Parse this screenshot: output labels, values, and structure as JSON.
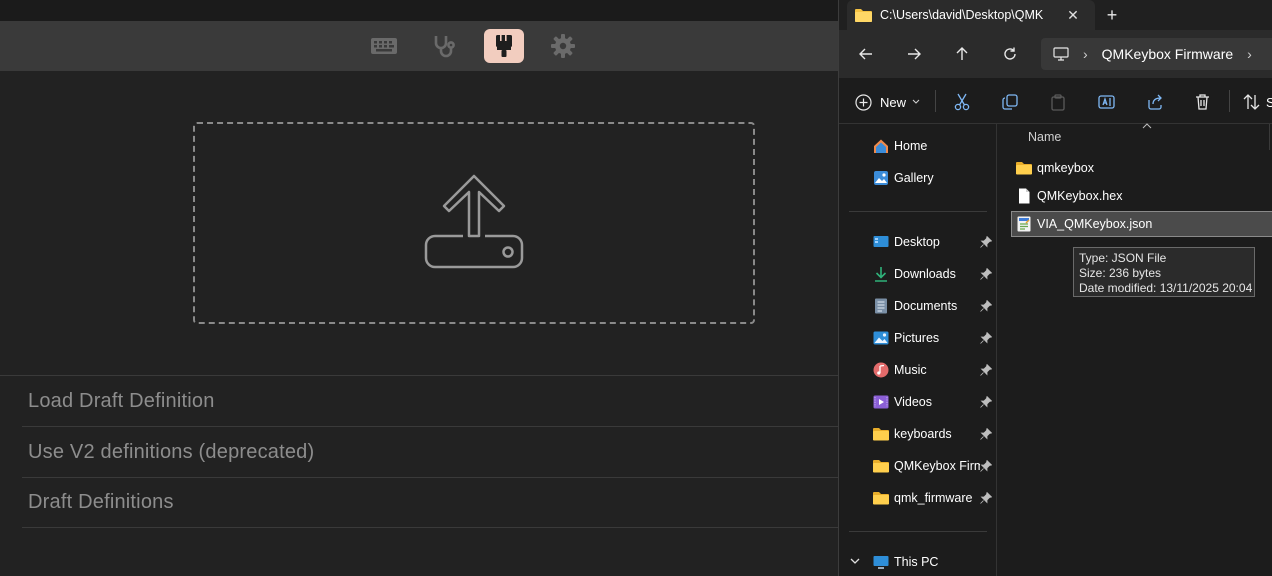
{
  "via": {
    "tabs": [
      {
        "icon": "keyboard-icon",
        "active": false
      },
      {
        "icon": "stethoscope-icon",
        "active": false
      },
      {
        "icon": "paintbrush-icon",
        "active": true
      },
      {
        "icon": "gear-icon",
        "active": false
      }
    ],
    "dropzone_icon": "upload-icon",
    "menu": [
      {
        "label": "Load Draft Definition"
      },
      {
        "label": "Use V2 definitions (deprecated)"
      },
      {
        "label": "Draft Definitions"
      }
    ],
    "colors": {
      "active_tab": "#f2cdbf",
      "text": "#8d8d8d",
      "background": "#222222"
    }
  },
  "explorer": {
    "tab_title": "C:\\Users\\david\\Desktop\\QMK",
    "tab_close": "✕",
    "new_tab": "+",
    "nav": {
      "back": "back-arrow-icon",
      "forward": "forward-arrow-icon",
      "up": "up-arrow-icon",
      "refresh": "refresh-icon"
    },
    "address": {
      "separator": "›",
      "folder": "QMKeybox Firmware",
      "trailing": "›"
    },
    "commands": {
      "new_label": "New",
      "last_label": "S"
    },
    "sidebar": {
      "top": [
        {
          "label": "Home",
          "icon": "home-icon"
        },
        {
          "label": "Gallery",
          "icon": "gallery-icon"
        }
      ],
      "pinned": [
        {
          "label": "Desktop",
          "icon": "desktop-icon"
        },
        {
          "label": "Downloads",
          "icon": "download-icon"
        },
        {
          "label": "Documents",
          "icon": "documents-icon"
        },
        {
          "label": "Pictures",
          "icon": "pictures-icon"
        },
        {
          "label": "Music",
          "icon": "music-icon"
        },
        {
          "label": "Videos",
          "icon": "videos-icon"
        },
        {
          "label": "keyboards",
          "icon": "folder-icon"
        },
        {
          "label": "QMKeybox Firmware",
          "icon": "folder-icon"
        },
        {
          "label": "qmk_firmware",
          "icon": "folder-icon"
        }
      ],
      "this_pc": "This PC"
    },
    "files": {
      "column_name": "Name",
      "rows": [
        {
          "name": "qmkeybox",
          "icon": "folder-icon",
          "selected": false
        },
        {
          "name": "QMKeybox.hex",
          "icon": "file-icon",
          "selected": false
        },
        {
          "name": "VIA_QMKeybox.json",
          "icon": "json-file-icon",
          "selected": true
        }
      ]
    },
    "tooltip": {
      "type": "Type: JSON File",
      "size": "Size: 236 bytes",
      "modified": "Date modified: 13/11/2025 20:04"
    },
    "colors": {
      "folder": "#f5c242",
      "accent": "#60cdff",
      "background": "#1c1c1c"
    }
  }
}
